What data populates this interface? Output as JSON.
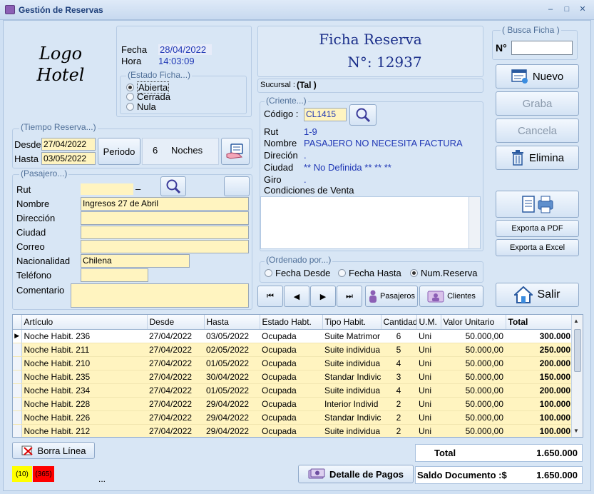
{
  "window": {
    "title": "Gestión de Reservas",
    "minimize": "–",
    "maximize": "□",
    "close": "✕"
  },
  "logo": {
    "line1": "Logo",
    "line2": "Hotel"
  },
  "ficha_info": {
    "fecha_label": "Fecha",
    "fecha_value": "28/04/2022",
    "hora_label": "Hora",
    "hora_value": "14:03:09",
    "estado_legend": "(Estado Ficha...)",
    "estado_options": [
      "Abierta",
      "Cerrada",
      "Nula"
    ],
    "estado_selected": "Abierta"
  },
  "header": {
    "title": "Ficha Reserva",
    "number": "N°: 12937",
    "sucursal_label": "Sucursal :",
    "sucursal_value": "(Tal )"
  },
  "busca": {
    "legend": "( Busca Ficha )",
    "label": "N°",
    "value": ""
  },
  "actions": {
    "nuevo": "Nuevo",
    "graba": "Graba",
    "cancela": "Cancela",
    "elimina": "Elimina",
    "exporta_pdf": "Exporta a PDF",
    "exporta_excel": "Exporta a Excel",
    "salir": "Salir"
  },
  "tiempo": {
    "legend": "(Tiempo Reserva...)",
    "desde_label": "Desde",
    "desde_value": "27/04/2022",
    "hasta_label": "Hasta",
    "hasta_value": "03/05/2022",
    "periodo_button": "Periodo",
    "noches_count": "6",
    "noches_label": "Noches"
  },
  "pasajero": {
    "legend": "(Pasajero...)",
    "rut_label": "Rut",
    "rut_value": "",
    "rut_dash": "–",
    "nombre_label": "Nombre",
    "nombre_value": "Ingresos 27 de Abril",
    "direccion_label": "Dirección",
    "direccion_value": "",
    "ciudad_label": "Ciudad",
    "ciudad_value": "",
    "correo_label": "Correo",
    "correo_value": "",
    "nacionalidad_label": "Nacionalidad",
    "nacionalidad_value": "Chilena",
    "telefono_label": "Teléfono",
    "telefono_value": "",
    "comentario_label": "Comentario",
    "comentario_value": ""
  },
  "cliente": {
    "legend": "(Criente...)",
    "codigo_label": "Código :",
    "codigo_value": "CL1415",
    "rut_label": "Rut",
    "rut_value": "1-9",
    "nombre_label": "Nombre",
    "nombre_value": "PASAJERO NO NECESITA FACTURA",
    "direccion_label": "Direción",
    "direccion_value": ".",
    "ciudad_label": "Ciudad",
    "ciudad_value": "** No Definida ** ** **",
    "giro_label": "Giro",
    "giro_value": ".",
    "condiciones_label": "Condiciones de Venta",
    "condiciones_value": ""
  },
  "ordenado": {
    "legend": "(Ordenado por...)",
    "options": [
      "Fecha Desde",
      "Fecha Hasta",
      "Num.Reserva"
    ],
    "selected": "Num.Reserva"
  },
  "nav": {
    "first": "⏮",
    "prev": "◀",
    "next": "▶",
    "last": "⏭",
    "pasajeros": "Pasajeros",
    "clientes": "Clientes"
  },
  "grid": {
    "columns": [
      "Artículo",
      "Desde",
      "Hasta",
      "Estado Habt.",
      "Tipo Habit.",
      "Cantidad",
      "U.M.",
      "Valor Unitario",
      "Total"
    ],
    "rows": [
      [
        "Noche Habit. 236",
        "27/04/2022",
        "03/05/2022",
        "Ocupada",
        "Suite Matrimor",
        "6",
        "Uni",
        "50.000,00",
        "300.000"
      ],
      [
        "Noche Habit. 211",
        "27/04/2022",
        "02/05/2022",
        "Ocupada",
        "Suite individua",
        "5",
        "Uni",
        "50.000,00",
        "250.000"
      ],
      [
        "Noche Habit. 210",
        "27/04/2022",
        "01/05/2022",
        "Ocupada",
        "Suite individua",
        "4",
        "Uni",
        "50.000,00",
        "200.000"
      ],
      [
        "Noche Habit. 235",
        "27/04/2022",
        "30/04/2022",
        "Ocupada",
        "Standar Indivic",
        "3",
        "Uni",
        "50.000,00",
        "150.000"
      ],
      [
        "Noche Habit. 234",
        "27/04/2022",
        "01/05/2022",
        "Ocupada",
        "Suite individua",
        "4",
        "Uni",
        "50.000,00",
        "200.000"
      ],
      [
        "Noche Habit. 228",
        "27/04/2022",
        "29/04/2022",
        "Ocupada",
        "Interior Individ",
        "2",
        "Uni",
        "50.000,00",
        "100.000"
      ],
      [
        "Noche Habit. 226",
        "27/04/2022",
        "29/04/2022",
        "Ocupada",
        "Standar Indivic",
        "2",
        "Uni",
        "50.000,00",
        "100.000"
      ],
      [
        "Noche Habit. 212",
        "27/04/2022",
        "29/04/2022",
        "Ocupada",
        "Suite individua",
        "2",
        "Uni",
        "50.000,00",
        "100.000"
      ]
    ],
    "selected_row": 0
  },
  "footer": {
    "borra_linea": "Borra Línea",
    "badge_yellow": "(10)",
    "badge_red": "(365)",
    "ellipsis": "...",
    "detalle_pagos": "Detalle de Pagos",
    "total_label": "Total",
    "total_value": "1.650.000",
    "saldo_label": "Saldo Documento :$",
    "saldo_value": "1.650.000"
  },
  "colors": {
    "input_bg": "#fff4c0",
    "value_blue": "#1f37b5",
    "badge_yellow": "#ffff00",
    "badge_red": "#ff0000"
  }
}
